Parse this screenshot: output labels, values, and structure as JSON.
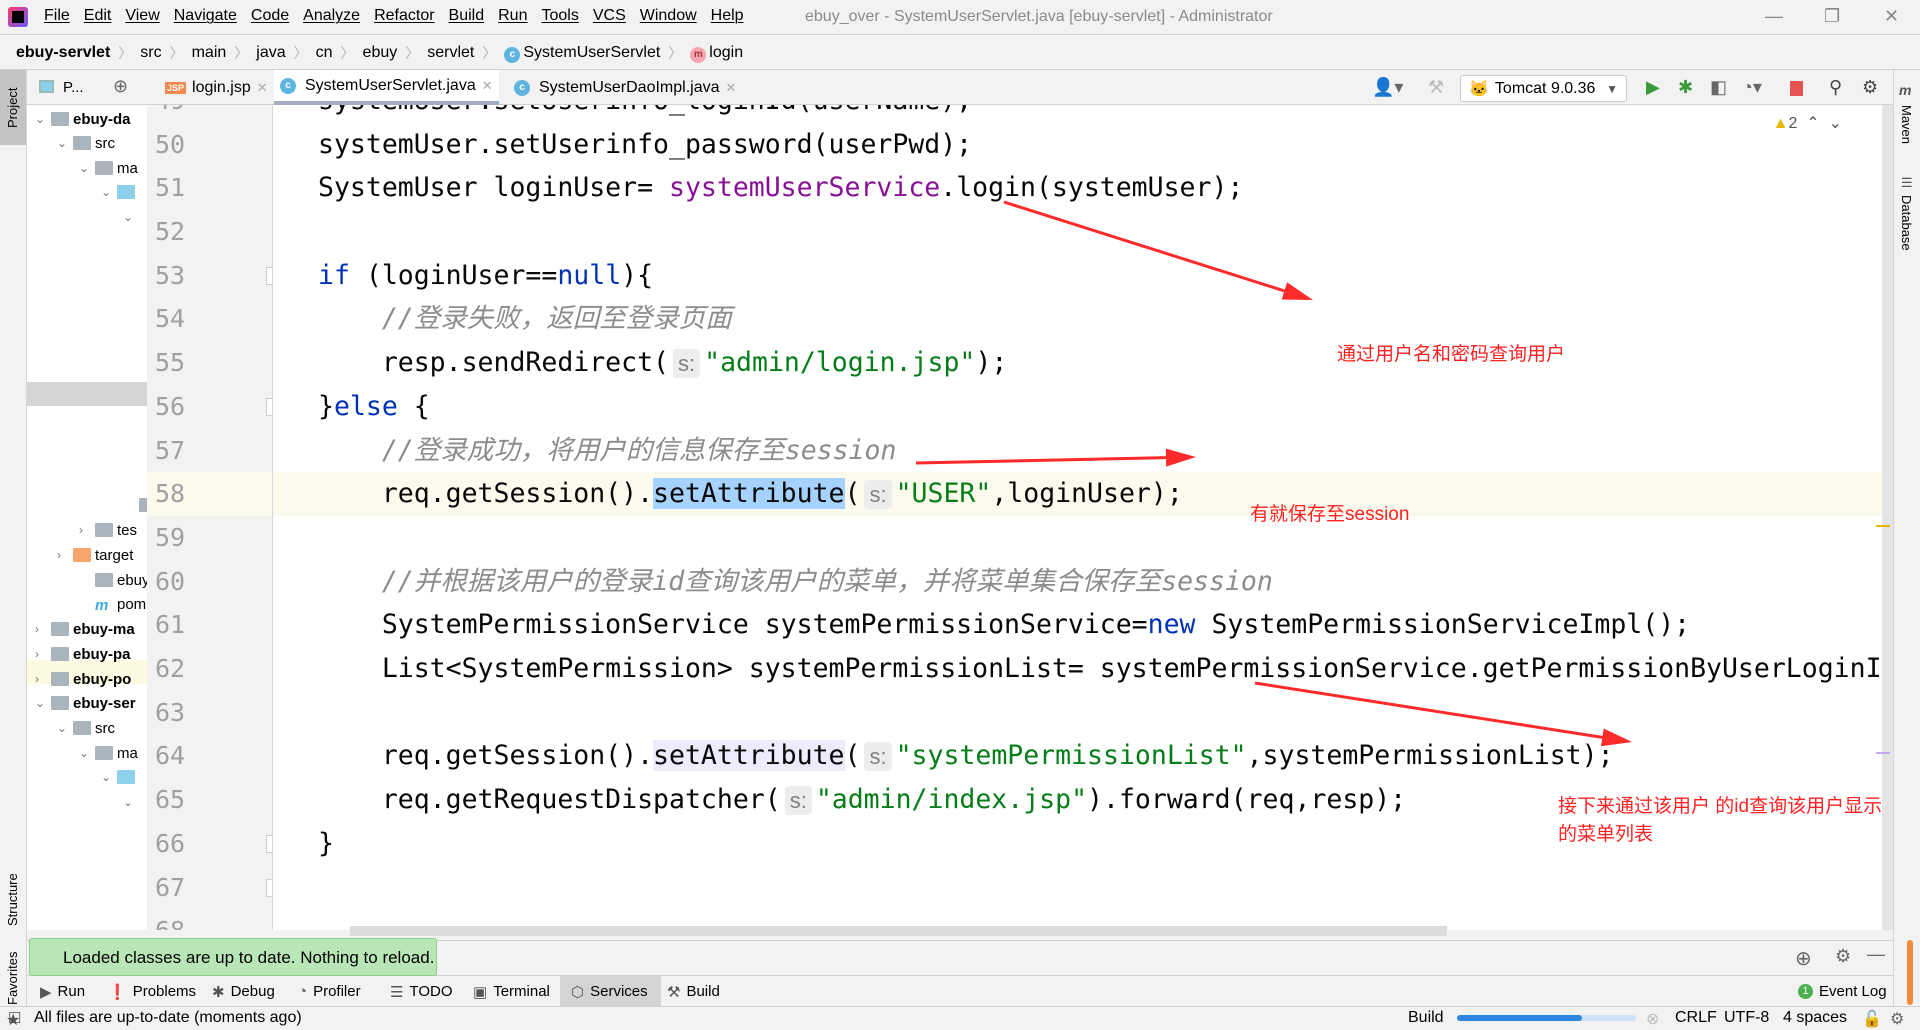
{
  "menu": [
    "File",
    "Edit",
    "View",
    "Navigate",
    "Code",
    "Analyze",
    "Refactor",
    "Build",
    "Run",
    "Tools",
    "VCS",
    "Window",
    "Help"
  ],
  "window_title": "ebuy_over - SystemUserServlet.java [ebuy-servlet] - Administrator",
  "breadcrumb": [
    "ebuy-servlet",
    "src",
    "main",
    "java",
    "cn",
    "ebuy",
    "servlet",
    "SystemUserServlet",
    "login"
  ],
  "toolbar": {
    "run_config": "Tomcat 9.0.36"
  },
  "left_strip": [
    "Project",
    "Structure",
    "Favorites"
  ],
  "right_strip": [
    "Maven",
    "Database"
  ],
  "project_panel": {
    "title": "P..."
  },
  "tree": [
    "ebuy-da",
    "src",
    "ma",
    "",
    "",
    "",
    "tes",
    "target",
    "ebuy-",
    "pom.x",
    "ebuy-ma",
    "ebuy-pa",
    "ebuy-po",
    "ebuy-ser",
    "src",
    "ma",
    "",
    ""
  ],
  "tabs": [
    {
      "label": "login.jsp",
      "icon": "jsp"
    },
    {
      "label": "SystemUserServlet.java",
      "icon": "class",
      "active": true
    },
    {
      "label": "SystemUserDaoImpl.java",
      "icon": "class"
    }
  ],
  "editor": {
    "warnings": "2",
    "first_line": 49,
    "current_line": 58,
    "lines": [
      [
        [
          "t",
          "systemUser.setUserinfo_loginId(userName);"
        ]
      ],
      [
        [
          "t",
          "systemUser.setUserinfo_password(userPwd);"
        ]
      ],
      [
        [
          "t",
          "SystemUser loginUser= "
        ],
        [
          "fld",
          "systemUserService"
        ],
        [
          "t",
          ".login(systemUser);"
        ]
      ],
      [],
      [
        [
          "kw",
          "if"
        ],
        [
          "t",
          " (loginUser=="
        ],
        [
          "kw",
          "null"
        ],
        [
          "t",
          "){"
        ]
      ],
      [
        [
          "t",
          "    "
        ],
        [
          "cmt",
          "//登录失败，返回至登录页面"
        ]
      ],
      [
        [
          "t",
          "    resp.sendRedirect("
        ],
        [
          "hint",
          "s:"
        ],
        [
          "str",
          "\"admin/login.jsp\""
        ],
        [
          "t",
          ");"
        ]
      ],
      [
        [
          "t",
          "}"
        ],
        [
          "kw",
          "else"
        ],
        [
          "t",
          " {"
        ]
      ],
      [
        [
          "t",
          "    "
        ],
        [
          "cmt",
          "//登录成功，将用户的信息保存至session"
        ]
      ],
      [
        [
          "t",
          "    req.getSession()."
        ],
        [
          "hl",
          "setAttribute"
        ],
        [
          "t",
          "("
        ],
        [
          "hint",
          "s:"
        ],
        [
          "str",
          "\"USER\""
        ],
        [
          "t",
          ",loginUser);"
        ]
      ],
      [],
      [
        [
          "t",
          "    "
        ],
        [
          "cmt",
          "//并根据该用户的登录id查询该用户的菜单，并将菜单集合保存至session"
        ]
      ],
      [
        [
          "t",
          "    SystemPermissionService systemPermissionService="
        ],
        [
          "kw",
          "new"
        ],
        [
          "t",
          " SystemPermissionServiceImpl();"
        ]
      ],
      [
        [
          "t",
          "    List<SystemPermission> systemPermissionList= systemPermissionService.getPermissionByUserLoginId("
        ]
      ],
      [],
      [
        [
          "t",
          "    req.getSession()."
        ],
        [
          "hl2",
          "setAttribute"
        ],
        [
          "t",
          "("
        ],
        [
          "hint",
          "s:"
        ],
        [
          "str",
          "\"systemPermissionList\""
        ],
        [
          "t",
          ",systemPermissionList);"
        ]
      ],
      [
        [
          "t",
          "    req.getRequestDispatcher("
        ],
        [
          "hint",
          "s:"
        ],
        [
          "str",
          "\"admin/index.jsp\""
        ],
        [
          "t",
          ").forward(req,resp);"
        ]
      ],
      [
        [
          "t",
          "}"
        ]
      ],
      [],
      []
    ]
  },
  "annotations": {
    "a1": "通过用户名和密码查询用户",
    "a2": "有就保存至session",
    "a3_line1": "接下来通过该用户 的id查询该用户显示",
    "a3_line2": "的菜单列表",
    "color": "#ff2a2a"
  },
  "tool_window": {
    "tab_partial": "Se",
    "toast": "Loaded classes are up to date. Nothing to reload."
  },
  "tool_tabs": [
    "Run",
    "Problems",
    "Debug",
    "Profiler",
    "TODO",
    "Terminal",
    "Services",
    "Build"
  ],
  "event_log": {
    "count": "1",
    "label": "Event Log"
  },
  "status": {
    "message": "All files are up-to-date (moments ago)",
    "task": "Build",
    "progress": 0.7,
    "line_sep": "CRLF",
    "encoding": "UTF-8",
    "indent": "4 spaces"
  }
}
